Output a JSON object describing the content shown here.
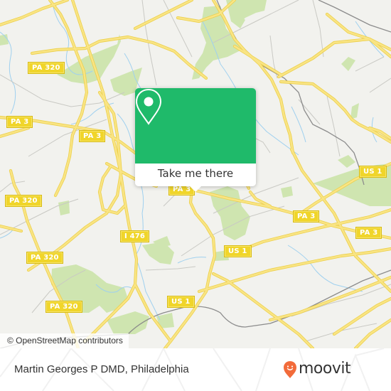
{
  "map": {
    "colors": {
      "background": "#f2f2ee",
      "park": "#cfe5b0",
      "major_road": "#f7e06e",
      "minor_road": "#c9c9c4",
      "water": "#9fd0ef",
      "rail": "#8c8c8c"
    },
    "route_labels": [
      {
        "id": "pa320-north",
        "text": "PA 320"
      },
      {
        "id": "pa3-west",
        "text": "PA 3"
      },
      {
        "id": "pa3-center-west",
        "text": "PA 3"
      },
      {
        "id": "pa320-west",
        "text": "PA 320"
      },
      {
        "id": "i476",
        "text": "I 476"
      },
      {
        "id": "pa320-southwest",
        "text": "PA 320"
      },
      {
        "id": "pa320-south",
        "text": "PA 320"
      },
      {
        "id": "pa3-center",
        "text": "PA 3"
      },
      {
        "id": "us1-center",
        "text": "US 1"
      },
      {
        "id": "us1-south",
        "text": "US 1"
      },
      {
        "id": "pa3-east",
        "text": "PA 3"
      },
      {
        "id": "us1-east",
        "text": "US 1"
      },
      {
        "id": "pa3-far-east",
        "text": "PA 3"
      }
    ],
    "attribution": "© OpenStreetMap contributors"
  },
  "popup": {
    "icon": "map-pin-icon",
    "action_label": "Take me there",
    "accent_color": "#1fba6a"
  },
  "footer": {
    "place_name": "Martin Georges P DMD, Philadelphia",
    "brand": {
      "name": "moovit",
      "logo_icon": "moovit-pin-smile-icon",
      "logo_color": "#f26b3a"
    }
  }
}
